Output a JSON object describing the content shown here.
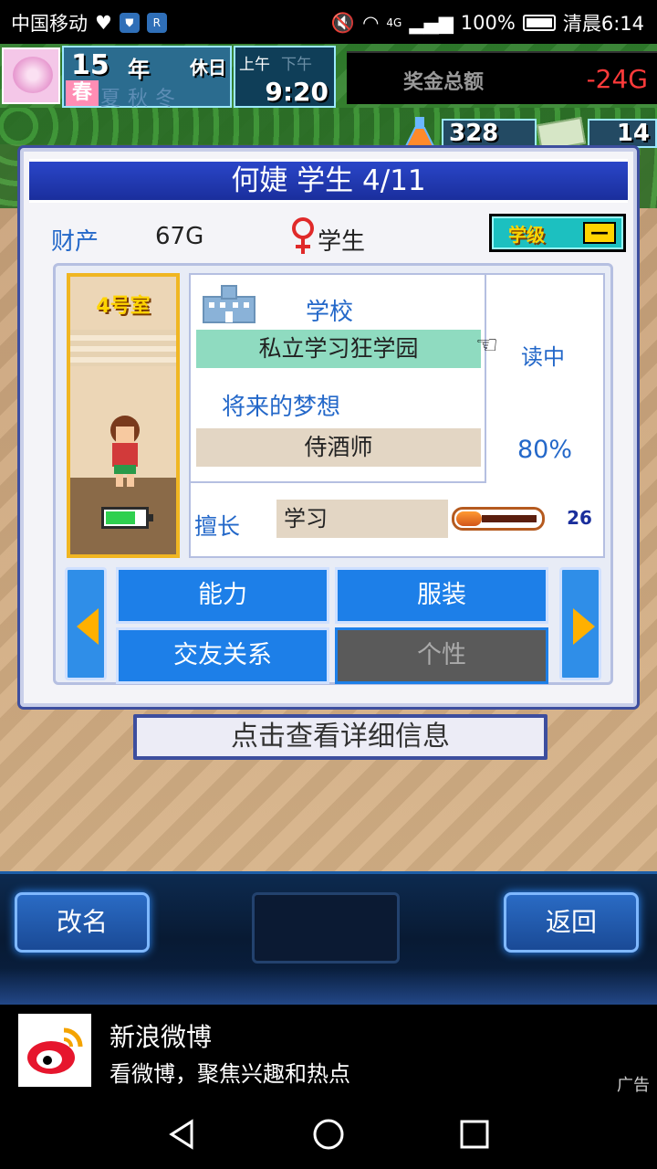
{
  "status_bar": {
    "carrier": "中国移动",
    "network": "4G",
    "battery": "100%",
    "time": "清晨6:14"
  },
  "hud": {
    "year": "15",
    "year_unit": "年",
    "holiday": "休日",
    "season": "春",
    "season_list": "夏秋冬",
    "am": "上午",
    "pm": "下午",
    "clock": "9:20",
    "fund_label": "奖金总额",
    "fund_value": "-24G",
    "research_points": "328",
    "tickets": "14"
  },
  "character": {
    "title": "何婕 学生 4/11",
    "asset_label": "财产",
    "asset_value": "67G",
    "role": "学生",
    "grade_label": "学级",
    "grade_value": "—",
    "room": "4号室",
    "stamina_fraction": 0.75
  },
  "details": {
    "school_label": "学校",
    "school_name": "私立学习狂学园",
    "status": "读中",
    "dream_label": "将来的梦想",
    "dream_value": "侍酒师",
    "dream_progress": "80%",
    "skill_label": "擅长",
    "skill_value": "学习",
    "skill_level": "26",
    "skill_fraction": 0.3
  },
  "tabs": {
    "ability": "能力",
    "clothing": "服装",
    "friends": "交友关系",
    "personality": "个性"
  },
  "hint": "点击查看详细信息",
  "bottom": {
    "rename": "改名",
    "back": "返回"
  },
  "ad": {
    "title": "新浪微博",
    "subtitle": "看微博，聚焦兴趣和热点",
    "tag": "广告"
  },
  "colors": {
    "title_blue": "#1a2e9c",
    "label_blue": "#2468c9",
    "tab_blue": "#1d7fe8",
    "fund_red": "#ff3a3a"
  }
}
